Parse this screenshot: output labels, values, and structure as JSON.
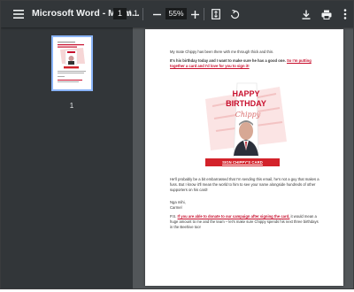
{
  "toolbar": {
    "title": "Microsoft Word - My m...",
    "page_current": "1",
    "page_sep": "/",
    "page_total": "1",
    "zoom": "55%"
  },
  "icons": {
    "menu": "menu-icon",
    "zoom_out": "minus-icon",
    "zoom_in": "plus-icon",
    "fit": "fit-page-icon",
    "rotate": "rotate-icon",
    "download": "download-icon",
    "print": "print-icon",
    "more": "more-vert-icon"
  },
  "sidebar": {
    "thumbnail_page": "1"
  },
  "document": {
    "intro": "My mate Chippy has been there with me through thick and thin.",
    "bold_line": "It's his birthday today and I want to make sure he has a good one.",
    "bold_link": "So I'm putting together a card and I'd love for you to sign it!",
    "card_title_1": "HAPPY",
    "card_title_2": "BIRTHDAY",
    "card_name": "Chippy",
    "cta": "SIGN CHIPPY'S CARD",
    "para_after": "He'll probably be a bit embarrassed that I'm sending this email, he's not a guy that makes a fuss. But I know it'll mean the world to him to see your name alongside hundreds of other supporters on his card!",
    "signoff_1": "Nga mihi,",
    "signoff_2": "Carmel",
    "ps_prefix": "P.S.",
    "ps_link": "If you are able to donate to our campaign after signing the card,",
    "ps_rest": "it would mean a huge amount to me and the team – let's make sure Chippy spends his next three birthdays in the Beehive too!"
  },
  "colors": {
    "toolbar_bg": "#323639",
    "viewer_bg": "#525659",
    "accent_red": "#c8102e",
    "thumbnail_border": "#8ab4f8"
  }
}
